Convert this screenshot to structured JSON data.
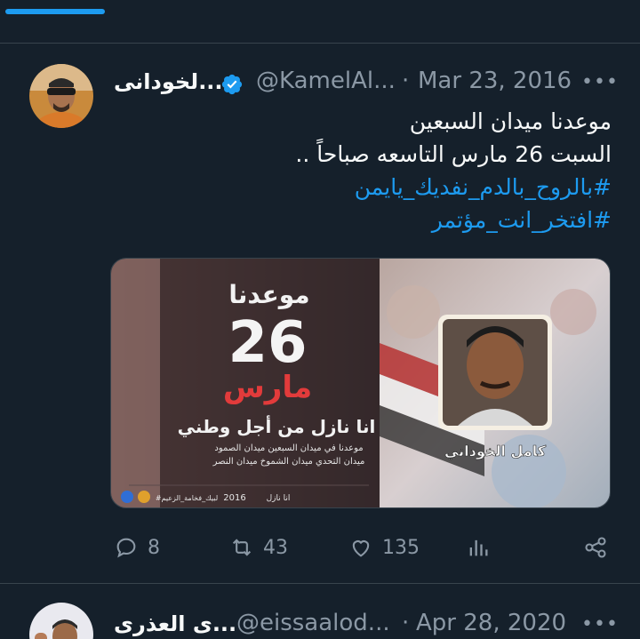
{
  "colors": {
    "background": "#15202b",
    "accent": "#1d9bf0",
    "muted": "#8b98a5",
    "border": "#38444d"
  },
  "tweet1": {
    "name": "...لخودانى",
    "handle": "@KamelAl...",
    "separator": "·",
    "date": "Mar 23, 2016",
    "more": "•••",
    "lines": [
      "موعدنا ميدان السبعين",
      "السبت 26 مارس التاسعه صباحاً .."
    ],
    "hashtags": [
      "#بالروح_بالدم_نفديك_يايمن",
      "#افتخر_انت_مؤتمر"
    ],
    "media": {
      "headline": "موعدنا",
      "number": "26",
      "month": "مارس",
      "slogan": "انا نازل من أجل وطني",
      "line1": "موعدنا في ميدان السبعين ميدان الصمود",
      "line2": "ميدان التحدي ميدان الشموخ ميدان النصر",
      "footer_year": "2016",
      "footer_tag": "انا نازل",
      "footer_tag2": "#لبيك_فخامة_الزعيم",
      "caption": "كامل الخوداني"
    },
    "actions": {
      "replies": "8",
      "retweets": "43",
      "likes": "135"
    }
  },
  "tweet2": {
    "name": "...ى العذرى",
    "handle": "@eissaalod...",
    "separator": "·",
    "date": "Apr 28, 2020",
    "more": "•••"
  }
}
